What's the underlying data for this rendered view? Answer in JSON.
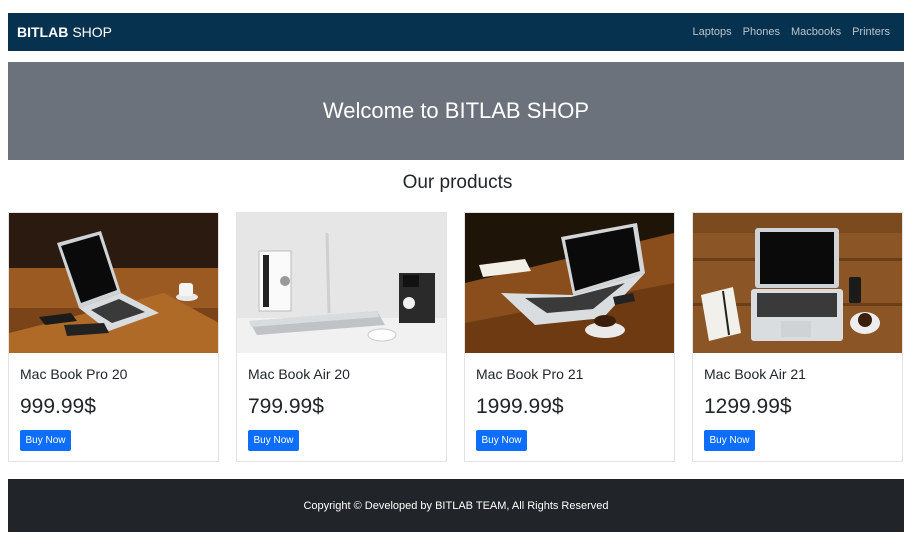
{
  "navbar": {
    "brand_bold": "BITLAB",
    "brand_rest": "SHOP",
    "links": [
      "Laptops",
      "Phones",
      "Macbooks",
      "Printers"
    ]
  },
  "hero": {
    "title": "Welcome to BITLAB SHOP"
  },
  "products_section": {
    "title": "Our products"
  },
  "products": [
    {
      "name": "Mac Book Pro 20",
      "price": "999.99$",
      "button": "Buy Now",
      "image": "laptop-on-wooden-table-image"
    },
    {
      "name": "Mac Book Air 20",
      "price": "799.99$",
      "button": "Buy Now",
      "image": "laptop-on-white-desk-image"
    },
    {
      "name": "Mac Book Pro 21",
      "price": "1999.99$",
      "button": "Buy Now",
      "image": "laptop-with-coffee-image"
    },
    {
      "name": "Mac Book Air 21",
      "price": "1299.99$",
      "button": "Buy Now",
      "image": "laptop-top-view-image"
    }
  ],
  "footer": {
    "text": "Copyright © Developed by BITLAB TEAM, All Rights Reserved"
  },
  "colors": {
    "navbar": "#06324f",
    "hero": "#6b727c",
    "button": "#0d6efd",
    "footer": "#212529"
  }
}
